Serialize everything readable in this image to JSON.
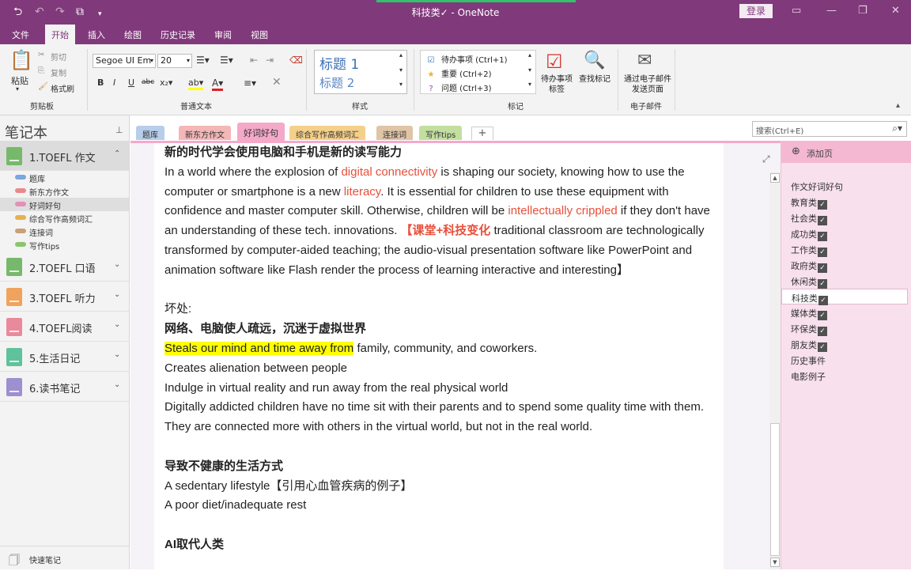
{
  "window": {
    "title": "科技类✓ - OneNote",
    "login_label": "登录"
  },
  "menus": [
    "文件",
    "开始",
    "插入",
    "绘图",
    "历史记录",
    "审阅",
    "视图"
  ],
  "ribbon": {
    "clipboard": {
      "paste": "粘贴",
      "cut": "剪切",
      "copy": "复制",
      "format_painter": "格式刷",
      "label": "剪贴板"
    },
    "text": {
      "font": "Segoe UI Em",
      "size": "20",
      "label": "普通文本"
    },
    "styles": {
      "heading1": "标题 1",
      "heading2": "标题 2",
      "label": "样式"
    },
    "tags": {
      "items": [
        "待办事项 (Ctrl+1)",
        "重要 (Ctrl+2)",
        "问题 (Ctrl+3)"
      ],
      "todo_tag": "待办事项标签",
      "find_tags": "查找标记",
      "label": "标记"
    },
    "email": {
      "button": "通过电子邮件发送页面",
      "label": "电子邮件"
    }
  },
  "sidebar": {
    "title": "笔记本",
    "notebooks": [
      {
        "label": "1.TOEFL 作文",
        "color": "#77b96a",
        "active": true
      },
      {
        "label": "2.TOEFL 口语",
        "color": "#77b96a"
      },
      {
        "label": "3.TOEFL 听力",
        "color": "#f0a35c"
      },
      {
        "label": "4.TOEFL阅读",
        "color": "#e88a9c"
      },
      {
        "label": "5.生活日记",
        "color": "#5fc29a"
      },
      {
        "label": "6.读书笔记",
        "color": "#9d8fd0"
      }
    ],
    "sections": [
      {
        "label": "题库",
        "color": "#7aa7e0"
      },
      {
        "label": "新东方作文",
        "color": "#e88a8a"
      },
      {
        "label": "好词好句",
        "color": "#e58fb6",
        "active": true
      },
      {
        "label": "综合写作高频词汇",
        "color": "#e6b14d"
      },
      {
        "label": "连接词",
        "color": "#c9a079"
      },
      {
        "label": "写作tips",
        "color": "#8cc46f"
      }
    ],
    "quick_notes": "快速笔记"
  },
  "tabs": [
    {
      "label": "题库",
      "color": "#b7cdea"
    },
    {
      "label": "新东方作文",
      "color": "#f4b7b7"
    },
    {
      "label": "好词好句",
      "color": "#f4a9c9",
      "active": true
    },
    {
      "label": "综合写作高频词汇",
      "color": "#f5d08a"
    },
    {
      "label": "连接词",
      "color": "#dfc4a6"
    },
    {
      "label": "写作tips",
      "color": "#c3df9f"
    }
  ],
  "add_tab_label": "+",
  "search": {
    "placeholder": "搜索(Ctrl+E)"
  },
  "note": {
    "heading1": "新的时代学会使用电脑和手机是新的读写能力",
    "p1": {
      "a": "In a world where the explosion of ",
      "b": "digital connectivity",
      "c": " is shaping our society, knowing how to use the computer or smartphone is a new ",
      "d": "literacy",
      "e": ". It is essential for children to use these equipment with confidence and master computer skill. Otherwise, children will be ",
      "f": "intellectually crippled",
      "g": " if they don't have an understanding of these tech. innovations. ",
      "h": "【课堂+科技变化",
      "i": " traditional classroom are technologically transformed by computer-aided teaching; the audio-visual presentation software like PowerPoint and animation software like Flash render the process of learning interactive and interesting】"
    },
    "bad_label": "坏处:",
    "heading2": "网络、电脑使人疏远，沉迷于虚拟世界",
    "steals_hl": "Steals our mind and time away from",
    "steals_rest": " family, community, and coworkers.",
    "line_alienation": "Creates alienation between people",
    "line_indulge": "Indulge in virtual reality and run away from the real physical world",
    "line_digital": "Digitally addicted children have no time sit with their parents and to spend some quality time with them. They are connected more with others in the virtual world, but not in the real world.",
    "heading3": "导致不健康的生活方式",
    "line_sedentary": "A sedentary lifestyle【引用心血管疾病的例子】",
    "line_diet": "A poor diet/inadequate rest",
    "heading4": "AI取代人类"
  },
  "pages_panel": {
    "add_page": "添加页",
    "pages": [
      {
        "label": "作文好词好句",
        "checked": false
      },
      {
        "label": "教育类",
        "checked": true
      },
      {
        "label": "社会类",
        "checked": true
      },
      {
        "label": "成功类",
        "checked": true
      },
      {
        "label": "工作类",
        "checked": true
      },
      {
        "label": "政府类",
        "checked": true
      },
      {
        "label": "休闲类",
        "checked": true
      },
      {
        "label": "科技类",
        "checked": true,
        "active": true
      },
      {
        "label": "媒体类",
        "checked": true
      },
      {
        "label": "环保类",
        "checked": true
      },
      {
        "label": "朋友类",
        "checked": true
      },
      {
        "label": "历史事件",
        "checked": false
      },
      {
        "label": "电影例子",
        "checked": false
      }
    ]
  }
}
